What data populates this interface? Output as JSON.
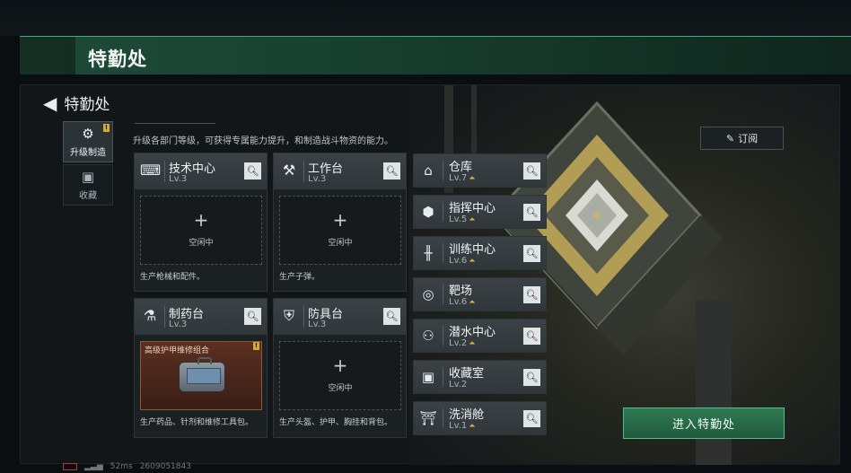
{
  "header": {
    "title": "特勤处"
  },
  "nav": {
    "back_label": "特勤处"
  },
  "side_tabs": [
    {
      "label": "升级制造",
      "icon": "craft-icon",
      "active": true
    },
    {
      "label": "收藏",
      "icon": "collection-icon",
      "active": false
    }
  ],
  "description": "升级各部门等级，可获得专属能力提升，和制造战斗物资的能力。",
  "cards": [
    {
      "name": "技术中心",
      "level": "Lv.3",
      "icon": "tech-icon",
      "slot_plus": "+",
      "slot_text": "空闲中",
      "footer": "生产枪械和配件。"
    },
    {
      "name": "工作台",
      "level": "Lv.3",
      "icon": "tools-icon",
      "slot_plus": "+",
      "slot_text": "空闲中",
      "footer": "生产子弹。"
    },
    {
      "name": "制药台",
      "level": "Lv.3",
      "icon": "pharma-icon",
      "slot_item": "高级护甲维修组合",
      "flag": "!",
      "footer": "生产药品、针剂和维修工具包。"
    },
    {
      "name": "防具台",
      "level": "Lv.3",
      "icon": "armor-icon",
      "slot_plus": "+",
      "slot_text": "空闲中",
      "footer": "生产头盔、护甲、胸挂和背包。"
    }
  ],
  "facilities": [
    {
      "name": "仓库",
      "level": "Lv.7",
      "upgradable": true,
      "icon": "warehouse-icon"
    },
    {
      "name": "指挥中心",
      "level": "Lv.5",
      "upgradable": true,
      "icon": "command-icon"
    },
    {
      "name": "训练中心",
      "level": "Lv.6",
      "upgradable": true,
      "icon": "training-icon"
    },
    {
      "name": "靶场",
      "level": "Lv.6",
      "upgradable": true,
      "icon": "target-icon"
    },
    {
      "name": "潜水中心",
      "level": "Lv.2",
      "upgradable": true,
      "icon": "diving-icon"
    },
    {
      "name": "收藏室",
      "level": "Lv.2",
      "upgradable": false,
      "icon": "collection-room-icon"
    },
    {
      "name": "洗消舱",
      "level": "Lv.1",
      "upgradable": true,
      "icon": "decon-icon"
    }
  ],
  "buttons": {
    "subscribe": "订阅",
    "enter": "进入特勤处"
  },
  "status": {
    "ping": "52ms",
    "id": "2609051843"
  },
  "colors": {
    "accent": "#3fae74",
    "upgrade": "#e1b33f"
  }
}
